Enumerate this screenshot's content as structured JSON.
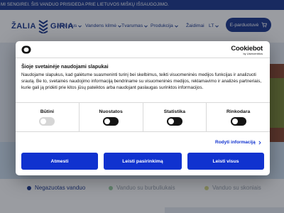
{
  "announcement": "MI SENGIREI. ŠIS VANDUO PRISIDEDA PRIE LIETUVOS MIŠKŲ IŠSAUGOJIMO.",
  "logo": {
    "word1": "ŽALIA",
    "word2": "GIRIA"
  },
  "nav": {
    "items": [
      "Apie mus",
      "Vandens kilmė",
      "Tvarumas",
      "Produkcija",
      "Žaidimai",
      "LT"
    ],
    "cta_label": "E-parduotuvė"
  },
  "features": [
    "Negazuotas vanduo",
    "Vanduo su burbuliukais",
    "Vanduo su skoniais"
  ],
  "colors": {
    "brand_blue": "#1f3b8f",
    "cookiebot_blue": "#1032cf"
  },
  "cookie_dialog": {
    "brand": "Cookiebot",
    "brand_sub": "by Usercentrics",
    "title": "Šioje svetainėje naudojami slapukai",
    "body": "Naudojame slapukus, kad galėtume suasmeninti turinį bei skelbimus, teikti visuomeninės medijos funkcijas ir analizuoti srautą. Be to, svetainės naudojimo informaciją bendriname su visuomeninės medijos, reklamavimo ir analizės partneriais, kurie gali ją pridėti prie kitos jūsų pateiktos arba naudojant paslaugas surinktos informacijos.",
    "categories": [
      {
        "label": "Būtini",
        "state": "on-disabled"
      },
      {
        "label": "Nuostatos",
        "state": "off"
      },
      {
        "label": "Statistika",
        "state": "off"
      },
      {
        "label": "Rinkodara",
        "state": "off"
      }
    ],
    "details_link": "Rodyti informaciją",
    "buttons": {
      "deny": "Atmesti",
      "selection": "Leisti pasirinkimą",
      "allow_all": "Leisti visus"
    }
  }
}
